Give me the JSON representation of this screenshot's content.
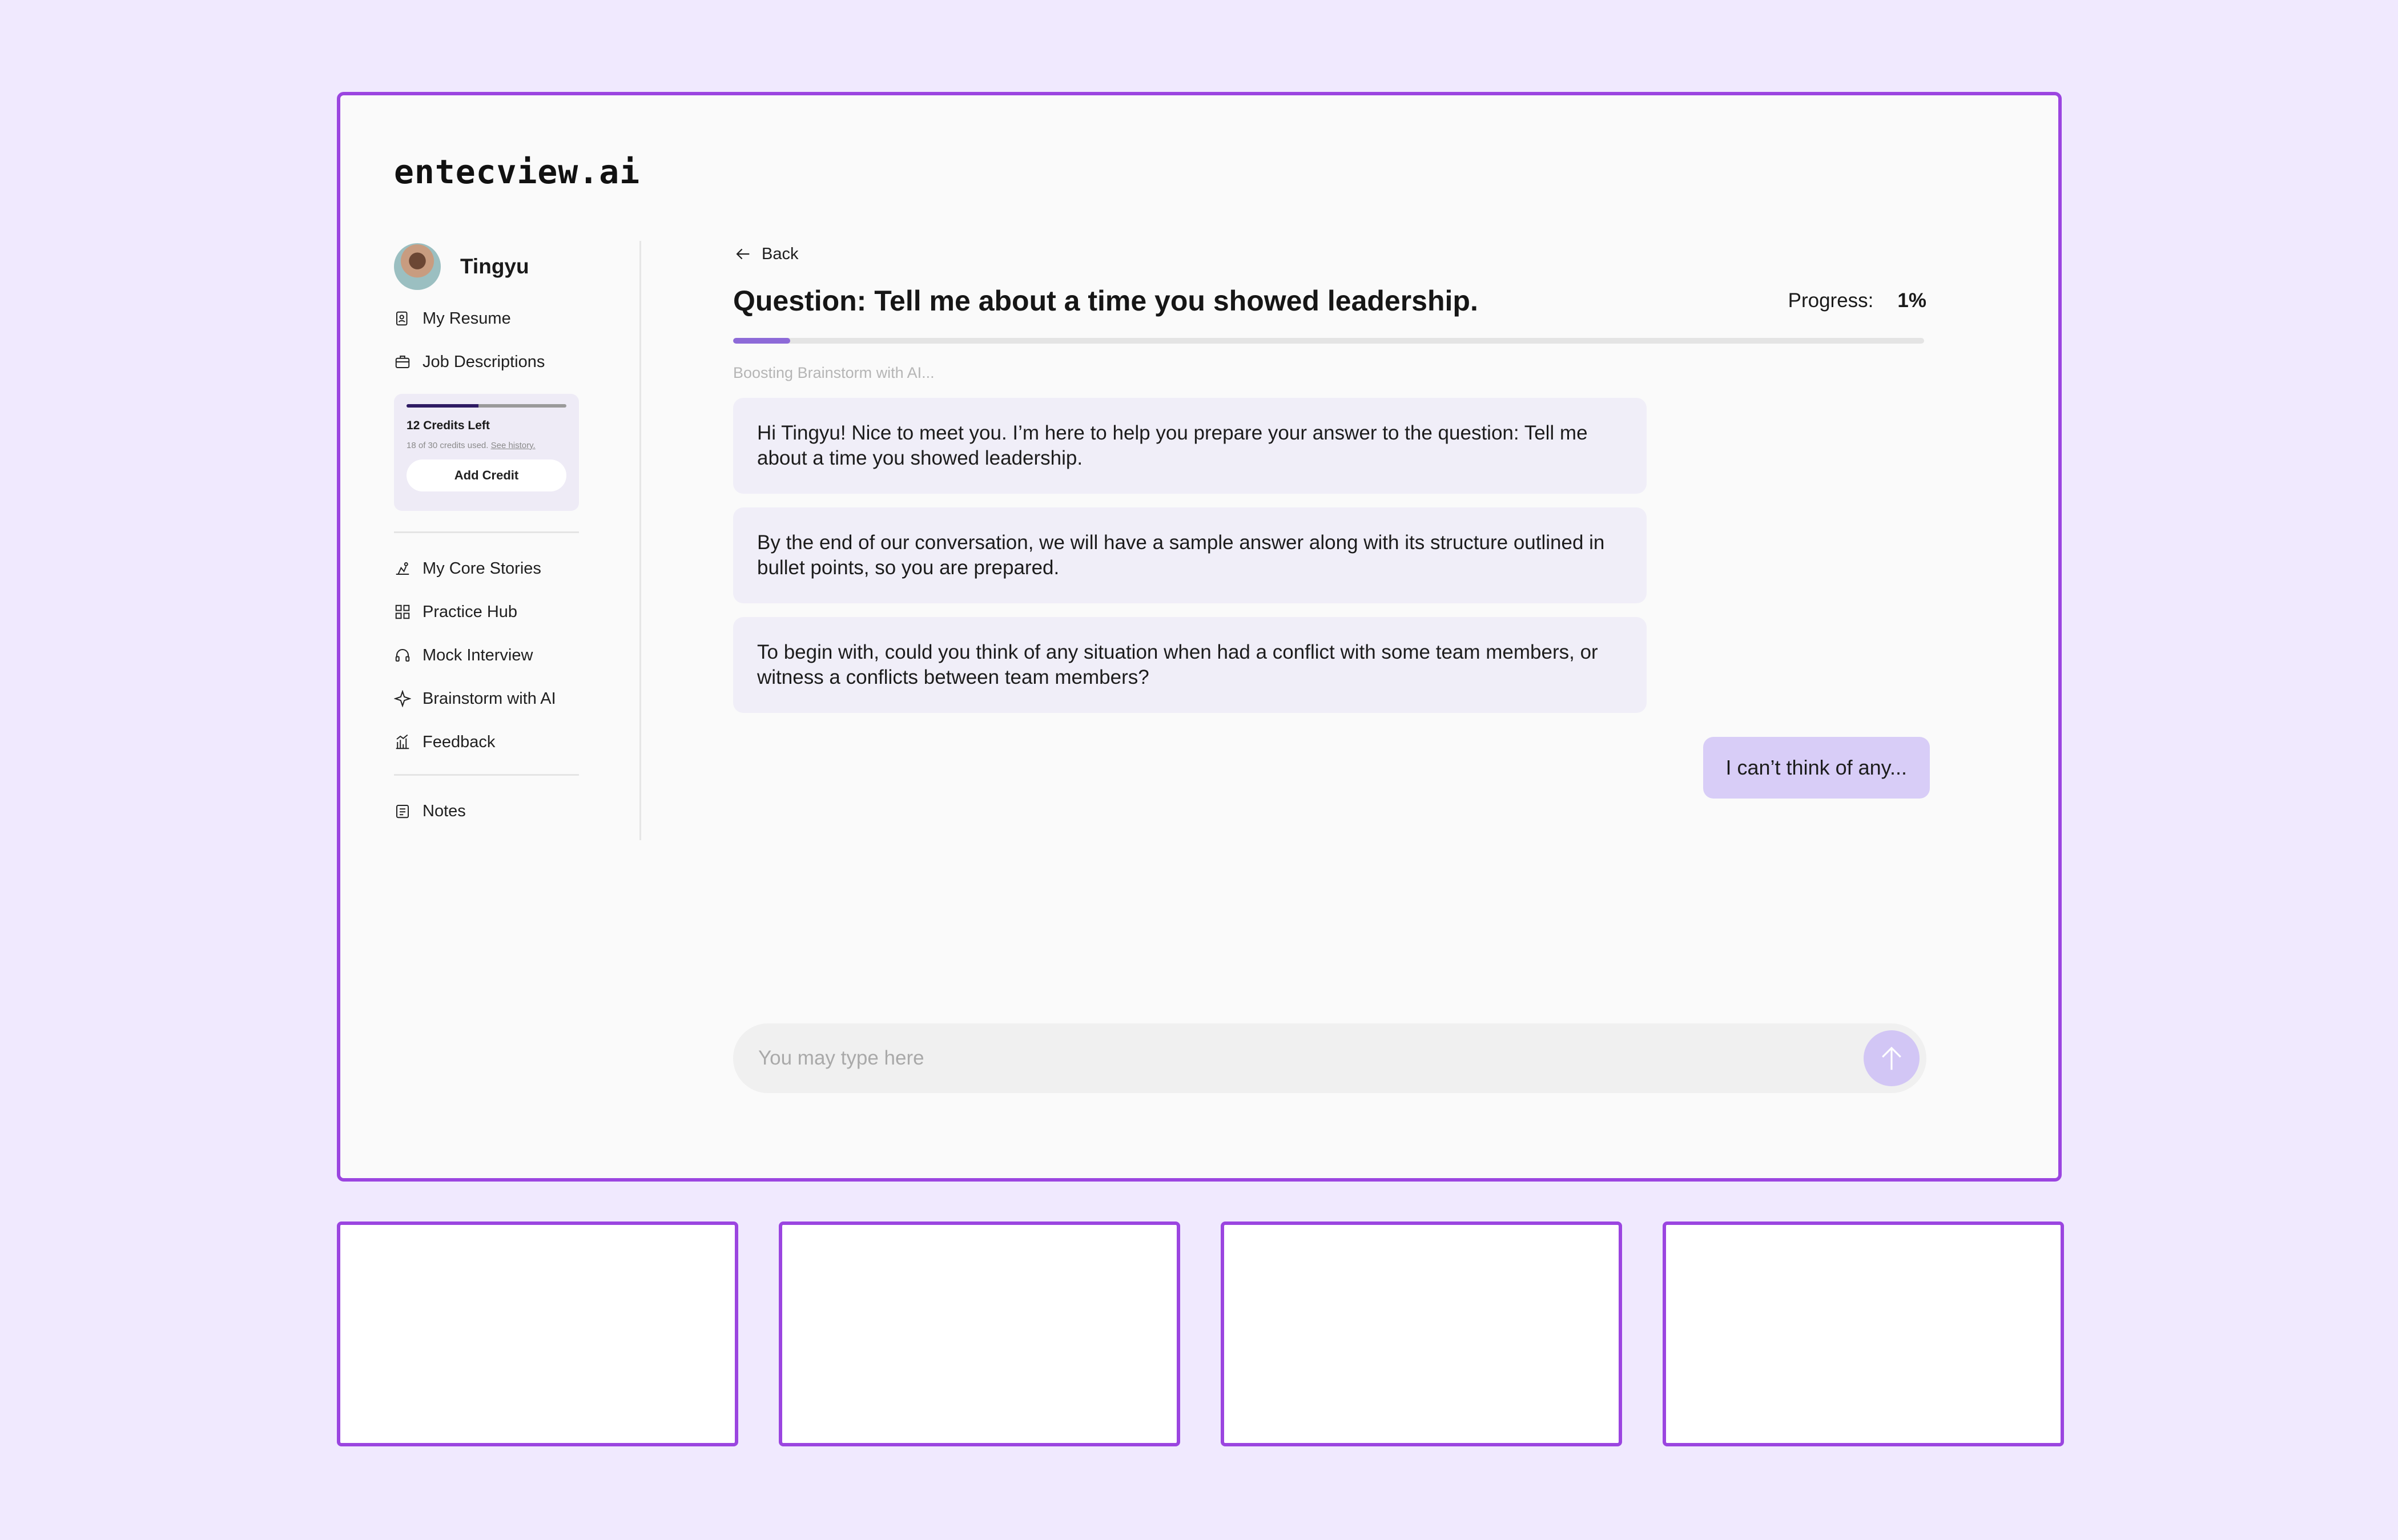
{
  "app": {
    "logo": "entecview.ai"
  },
  "sidebar": {
    "user_name": "Tingyu",
    "top_items": [
      {
        "label": "My Resume",
        "icon": "resume-icon"
      },
      {
        "label": "Job Descriptions",
        "icon": "briefcase-icon"
      }
    ],
    "credits": {
      "title": "12 Credits Left",
      "used_text": "18 of 30 credits used.",
      "history_link": "See history.",
      "used_fraction": 0.45,
      "add_label": "Add Credit"
    },
    "mid_items": [
      {
        "label": "My Core Stories",
        "icon": "core-stories-icon"
      },
      {
        "label": "Practice Hub",
        "icon": "grid-icon"
      },
      {
        "label": "Mock Interview",
        "icon": "headset-icon"
      },
      {
        "label": "Brainstorm with AI",
        "icon": "sparkle-icon"
      },
      {
        "label": "Feedback",
        "icon": "chart-icon"
      }
    ],
    "bottom_items": [
      {
        "label": "Notes",
        "icon": "notes-icon"
      }
    ]
  },
  "main": {
    "back_label": "Back",
    "title": "Question: Tell me about a time you showed leadership.",
    "progress_label": "Progress:",
    "progress_value": "1%",
    "progress_fraction": 0.048,
    "status": "Boosting Brainstorm with AI...",
    "ai_messages": [
      "Hi Tingyu! Nice to meet you. I’m here to help you prepare your answer to the question: Tell me about a time you showed leadership.",
      "By the end of our conversation, we will have a sample answer along with its structure outlined in bullet points, so you are prepared.",
      "To begin with, could you think of any situation when had a conflict with some team members, or witness a conflicts between team members?"
    ],
    "user_message": "I can’t think of any...",
    "input_placeholder": "You may type here"
  },
  "colors": {
    "background": "#f0e9fe",
    "frame_border": "#9b45e0",
    "accent": "#8d6ad8",
    "user_bubble": "#d8cdf7",
    "ai_bubble": "#f0eef8"
  }
}
